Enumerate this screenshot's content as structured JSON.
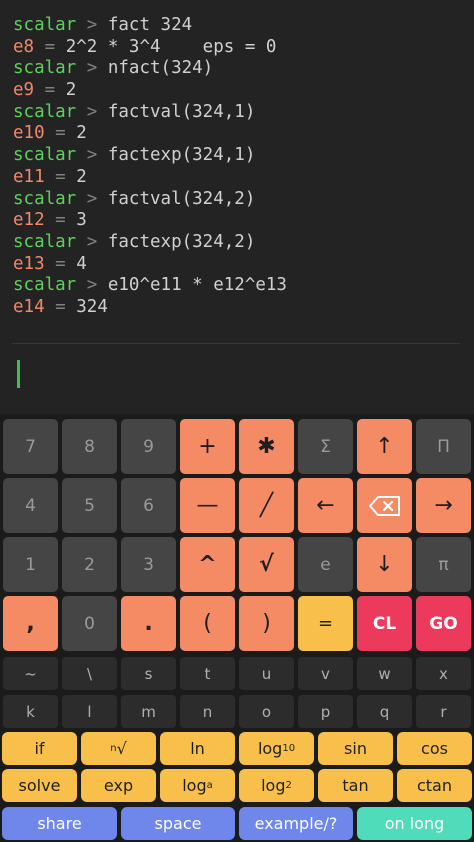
{
  "console": {
    "prompt": "scalar",
    "gt": ">",
    "eq": "=",
    "lines": [
      {
        "cmd": "fact 324",
        "name": "e8",
        "value": "2^2 * 3^4    eps = 0"
      },
      {
        "cmd": "nfact(324)",
        "name": "e9",
        "value": "2"
      },
      {
        "cmd": "factval(324,1)",
        "name": "e10",
        "value": "2"
      },
      {
        "cmd": "factexp(324,1)",
        "name": "e11",
        "value": "2"
      },
      {
        "cmd": "factval(324,2)",
        "name": "e12",
        "value": "3"
      },
      {
        "cmd": "factexp(324,2)",
        "name": "e13",
        "value": "4"
      },
      {
        "cmd": "e10^e11 * e12^e13",
        "name": "e14",
        "value": "324"
      }
    ]
  },
  "keys": {
    "k7": "7",
    "k8": "8",
    "k9": "9",
    "plus": "+",
    "times": "✱",
    "sum": "Σ",
    "up": "↑",
    "prod": "Π",
    "k4": "4",
    "k5": "5",
    "k6": "6",
    "minus": "—",
    "divide": "╱",
    "left": "←",
    "right": "→",
    "k1": "1",
    "k2": "2",
    "k3": "3",
    "caret": "^",
    "sqrt": "√",
    "e": "e",
    "down": "↓",
    "pi": "π",
    "comma": ",",
    "k0": "0",
    "dot": ".",
    "lparen": "(",
    "rparen": ")",
    "equals": "=",
    "clear": "CL",
    "go": "GO",
    "tilde": "~",
    "backslash": "\\",
    "s": "s",
    "t": "t",
    "u": "u",
    "v": "v",
    "w": "w",
    "x": "x",
    "k": "k",
    "l": "l",
    "m": "m",
    "n": "n",
    "o": "o",
    "p": "p",
    "q": "q",
    "r": "r",
    "if": "if",
    "nroot_sup": "n",
    "nroot_sym": "√",
    "ln": "ln",
    "log10": "log",
    "log10_sub": "10",
    "sin": "sin",
    "cos": "cos",
    "solve": "solve",
    "exp": "exp",
    "loga": "log",
    "loga_sub": "a",
    "log2": "log",
    "log2_sub": "2",
    "tan": "tan",
    "ctan": "ctan",
    "share": "share",
    "space": "space",
    "example": "example/?",
    "onlong": "on long"
  },
  "colors": {
    "prompt": "#5fcf5f",
    "result_name": "#f0886a",
    "number_key": "#454545",
    "operator_key": "#f58b64",
    "function_key": "#f8c04b",
    "action_key": "#ec3a5c",
    "bottom_key": "#6f86ea",
    "on_long_key": "#4fdcbb",
    "cursor": "#3fbf4f"
  }
}
